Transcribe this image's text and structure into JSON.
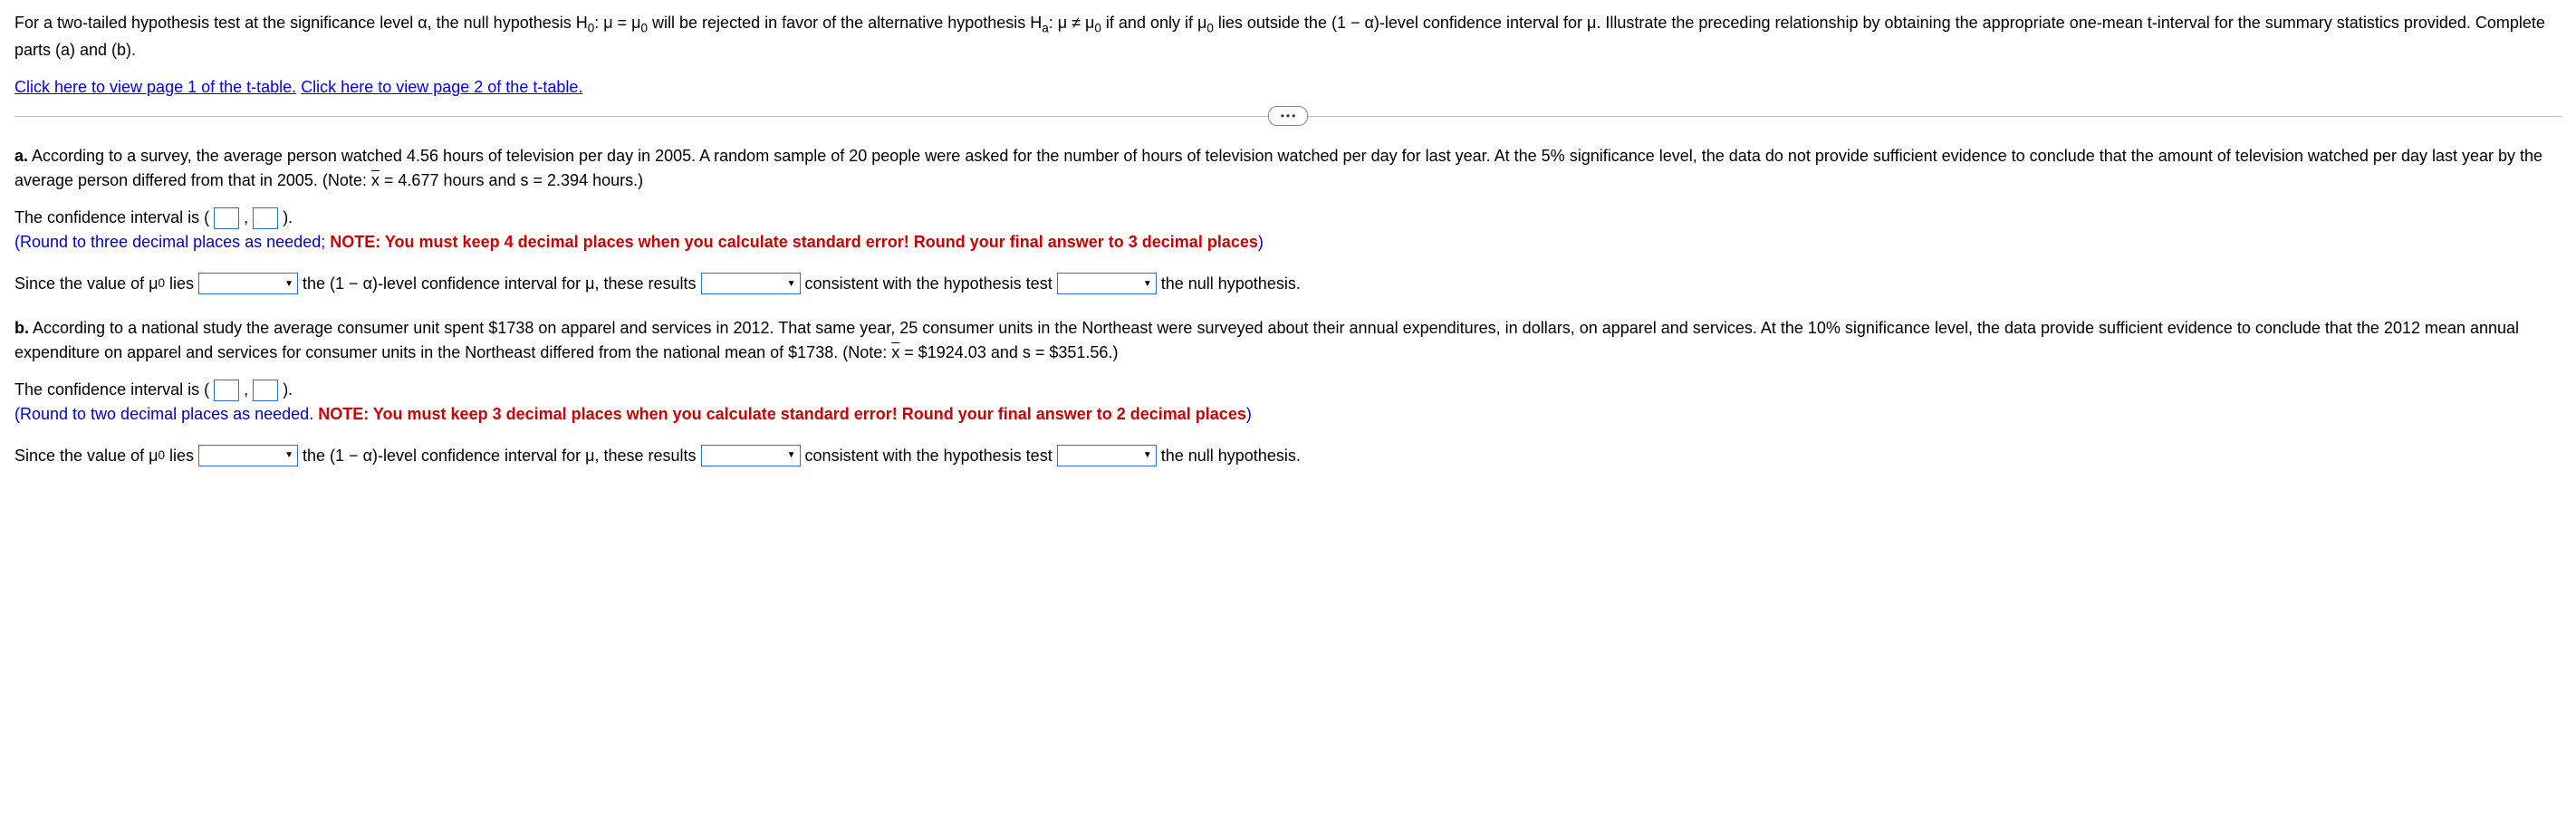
{
  "intro": {
    "text_before_h0": "For a two-tailed hypothesis test at the significance level α, the null hypothesis H",
    "h0_sub": "0",
    "h0_colon": ": μ = μ",
    "h0_sub2": "0",
    "text_mid": " will be rejected in favor of the alternative hypothesis H",
    "ha_sub": "a",
    "ha_colon": ": μ ≠ μ",
    "ha_sub2": "0",
    "text_iff": " if and only if μ",
    "mu0_sub": "0",
    "text_end": " lies outside the (1 − α)-level confidence interval for μ. Illustrate the preceding relationship by obtaining the appropriate one-mean t-interval for the summary statistics provided. Complete parts (a) and (b)."
  },
  "links": {
    "page1": "Click here to view page 1 of the t-table.",
    "page2": "Click here to view page 2 of the t-table."
  },
  "partA": {
    "label": "a.",
    "body": " According to a survey, the average person watched 4.56 hours of television per day in 2005. A random sample of 20 people were asked for the number of hours of television watched per day for last year. At the 5% significance level, the data do not provide sufficient evidence to conclude that the amount of television watched per day last year by the average person differed from that in 2005. (Note: ",
    "xbar": "x",
    "stat_xbar": " = 4.677 hours and s = 2.394 hours.)",
    "ci_prefix": "The confidence interval is (",
    "ci_comma": ",",
    "ci_suffix": ").",
    "round_blue": "(Round to three decimal places as needed; ",
    "round_red": "NOTE: You must keep 4 decimal places when you calculate standard error! Round your final answer to 3 decimal places",
    "round_blue_end": ")",
    "s1": "Since the value of μ",
    "s1_sub": "0",
    "s1_after": " lies",
    "s2": " the (1 − α)-level confidence interval for μ, these results",
    "s3": " consistent with the hypothesis test",
    "s4": " the null hypothesis."
  },
  "partB": {
    "label": "b.",
    "body": " According to a national study the average consumer unit spent $1738 on apparel and services in 2012. That same year, 25 consumer units in the Northeast were surveyed about their annual expenditures, in dollars, on apparel and services. At the 10% significance level, the data provide sufficient evidence to conclude that the 2012 mean annual expenditure on apparel and services for consumer units in the Northeast differed from the national mean of $1738. (Note: ",
    "xbar": "x",
    "stat_xbar": " = $1924.03 and s = $351.56.)",
    "ci_prefix": "The confidence interval is (",
    "ci_comma": ",",
    "ci_suffix": ").",
    "round_blue": "(Round to two decimal places as needed. ",
    "round_red": "NOTE: You must keep 3 decimal places when you calculate standard error! Round your final answer to 2 decimal places",
    "round_blue_end": ")",
    "s1": "Since the value of μ",
    "s1_sub": "0",
    "s1_after": " lies",
    "s2": " the (1 − α)-level confidence interval for μ, these results",
    "s3": " consistent with the hypothesis test",
    "s4": " the null hypothesis."
  }
}
